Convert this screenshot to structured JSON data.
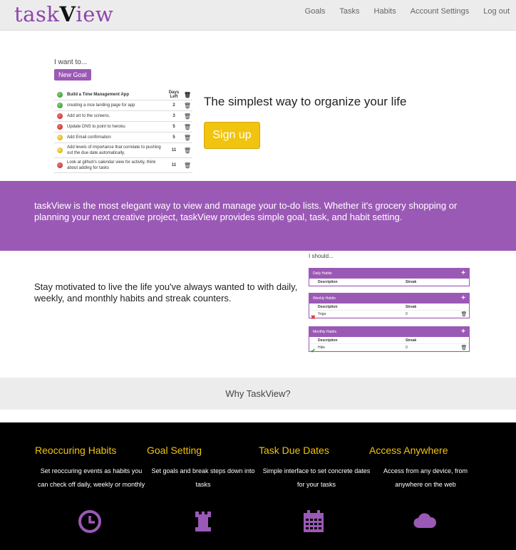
{
  "nav": {
    "logo_text": "task",
    "logo_v": "V",
    "logo_rest": "iew",
    "links": [
      "Goals",
      "Tasks",
      "Habits",
      "Account Settings",
      "Log out"
    ]
  },
  "hero": {
    "i_want": "I want to...",
    "new_goal": "New Goal",
    "table_header": {
      "title": "Build a Time Management App",
      "days_left": "Days Left"
    },
    "goals": [
      {
        "color": "green",
        "text": "creating a nice landing page for app",
        "days": "2"
      },
      {
        "color": "red",
        "text": "Add art to the screens.",
        "days": "3"
      },
      {
        "color": "red",
        "text": "Update DNS to point to heroku",
        "days": "5"
      },
      {
        "color": "yellow",
        "text": "Add Email confirmation",
        "days": "5"
      },
      {
        "color": "yellow",
        "text": "Add levels of importance that correlate to pushing out the due date automatically.",
        "days": "11"
      },
      {
        "color": "red",
        "text": "Look at github's calendar view for activity, think about adding for tasks",
        "days": "11"
      }
    ],
    "tagline": "The simplest way to organize your life",
    "signup": "Sign up"
  },
  "purple_band": {
    "text": "taskView is the most elegant way to view and manage your to-do lists. Whether it's grocery shopping or planning your next creative project, taskView provides simple goal, task, and habit setting."
  },
  "habits": {
    "text": "Stay motivated to live the life you've always wanted to with daily, weekly, and monthly habits and streak counters.",
    "i_should": "I should...",
    "panels": [
      {
        "title": "Daily Habits",
        "col_desc": "Description",
        "col_streak": "Streak",
        "rows": []
      },
      {
        "title": "Weekly Habits",
        "col_desc": "Description",
        "col_streak": "Streak",
        "rows": [
          {
            "status": "x",
            "name": "Yoga",
            "streak": "0"
          }
        ]
      },
      {
        "title": "Monthly Habits",
        "col_desc": "Description",
        "col_streak": "Streak",
        "rows": [
          {
            "status": "check",
            "name": "Hike",
            "streak": "0"
          }
        ]
      }
    ]
  },
  "why": {
    "title": "Why TaskView?"
  },
  "features": [
    {
      "title": "Reoccuring Habits",
      "text": "Set reoccuring events as habits you can check off daily, weekly or monthly",
      "icon": "clock-icon"
    },
    {
      "title": "Goal Setting",
      "text": "Set goals and break steps down into tasks",
      "icon": "rook-icon"
    },
    {
      "title": "Task Due Dates",
      "text": "Simple interface to set concrete dates for your tasks",
      "icon": "calendar-icon"
    },
    {
      "title": "Access Anywhere",
      "text": "Access from any device, from anywhere on the web",
      "icon": "cloud-icon"
    }
  ],
  "colors": {
    "purple": "#9b59b6",
    "yellow": "#f1c40f"
  }
}
